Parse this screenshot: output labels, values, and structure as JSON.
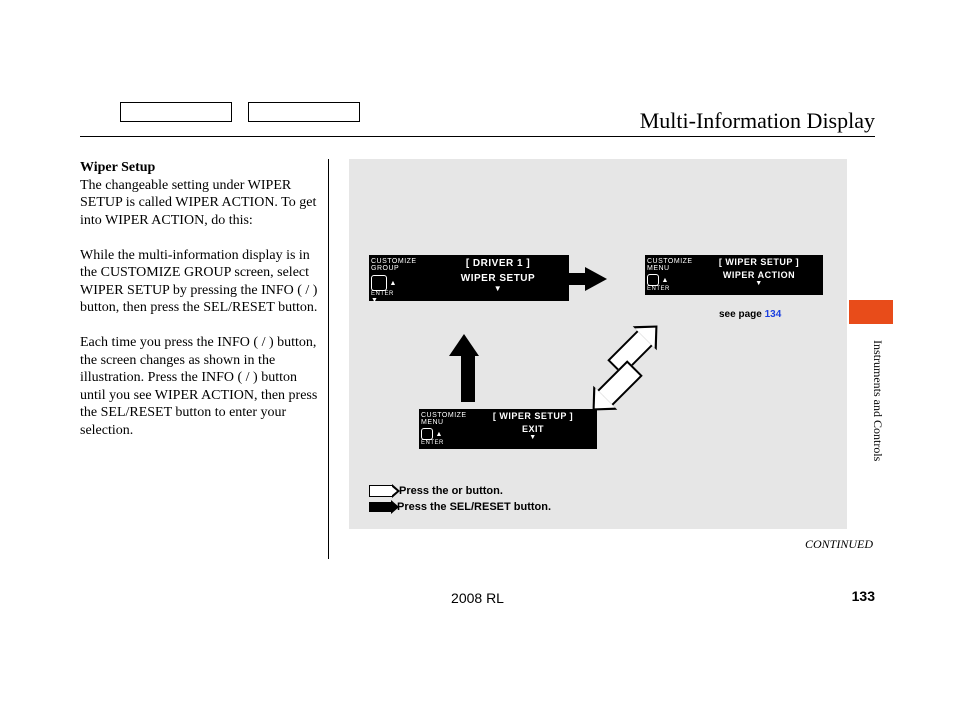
{
  "header": {
    "title": "Multi-Information Display"
  },
  "sidebar_label": "Instruments and Controls",
  "text_column": {
    "heading": "Wiper Setup",
    "p1": "The changeable setting under WIPER SETUP is called WIPER ACTION. To get into WIPER ACTION, do this:",
    "p2": "While the multi-information display is in the CUSTOMIZE GROUP screen, select WIPER SETUP by pressing the INFO (    /    ) button, then press the SEL/RESET button.",
    "p3": "Each time you press the INFO (    /    ) button, the screen changes as shown in the illustration. Press the INFO (    /    ) button until you see WIPER ACTION, then press the SEL/RESET button to enter your selection."
  },
  "diagram": {
    "lcd1": {
      "side1": "CUSTOMIZE",
      "side2": "GROUP",
      "enter": "ENTER",
      "row1": "[ DRIVER 1 ]",
      "row2": "WIPER SETUP"
    },
    "lcd2": {
      "side1": "CUSTOMIZE",
      "side2": "MENU",
      "enter": "ENTER",
      "row1": "[ WIPER SETUP ]",
      "row2": "WIPER ACTION"
    },
    "lcd3": {
      "side1": "CUSTOMIZE",
      "side2": "MENU",
      "enter": "ENTER",
      "row1": "[ WIPER SETUP ]",
      "row2": "EXIT"
    },
    "see_page_prefix": "see page ",
    "see_page_num": "134",
    "legend1": "Press the      or      button.",
    "legend2": "Press the SEL/RESET button."
  },
  "continued": "CONTINUED",
  "footer": {
    "model": "2008  RL",
    "page": "133"
  }
}
